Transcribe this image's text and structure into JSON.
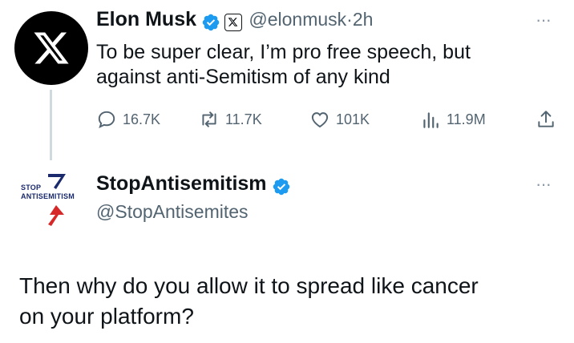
{
  "tweet": {
    "author_name": "Elon Musk",
    "handle": "@elonmusk",
    "separator": "·",
    "time": "2h",
    "more": "···",
    "text_line1": "To be super clear, I’m pro free speech, but",
    "text_line2": "against anti-Semitism of any kind",
    "actions": {
      "replies": "16.7K",
      "reposts": "11.7K",
      "likes": "101K",
      "views": "11.9M"
    }
  },
  "reply": {
    "author_name": "StopAntisemitism",
    "handle": "@StopAntisemites",
    "more": "···",
    "avatar_logo_line1": "STOP",
    "avatar_logo_line2": "ANTISEMITISM",
    "text_line1": "Then why do you allow it to spread like cancer",
    "text_line2": "on your platform?"
  },
  "colors": {
    "verified": "#1d9bf0",
    "muted": "#536471",
    "logo_blue": "#1a2a6c",
    "logo_red": "#d62828"
  },
  "icons": [
    "x-logo-icon",
    "verified-badge-icon",
    "x-affiliation-badge-icon",
    "more-icon",
    "reply-icon",
    "repost-icon",
    "like-icon",
    "views-icon",
    "share-icon"
  ]
}
